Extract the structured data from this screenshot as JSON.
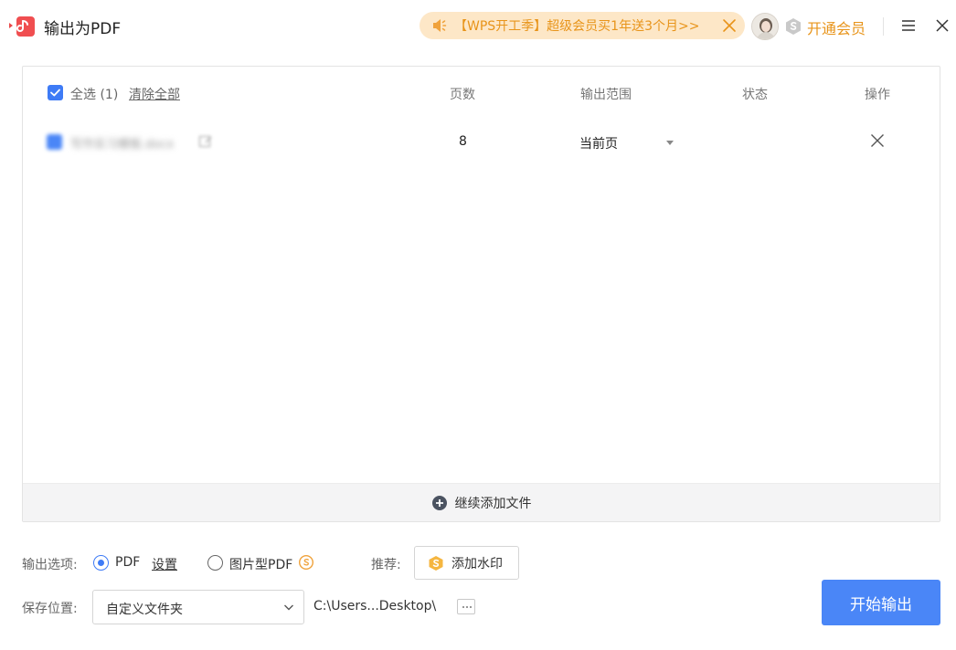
{
  "window": {
    "title": "输出为PDF",
    "promo_text": "【WPS开工季】超级会员买1年送3个月>>",
    "vip_label": "开通会员"
  },
  "list": {
    "select_all_label": "全选",
    "select_all_count": "(1)",
    "clear_all_label": "清除全部",
    "columns": {
      "pages": "页数",
      "range": "输出范围",
      "status": "状态",
      "action": "操作"
    },
    "rows": [
      {
        "file_name": "写作实习模板.docx",
        "pages": "8",
        "range": "当前页",
        "status": ""
      }
    ],
    "add_more_label": "继续添加文件"
  },
  "options": {
    "label": "输出选项:",
    "pdf_label": "PDF",
    "settings_label": "设置",
    "image_pdf_label": "图片型PDF",
    "selected": "PDF"
  },
  "recommend": {
    "label": "推荐:",
    "watermark_label": "添加水印"
  },
  "save": {
    "label": "保存位置:",
    "folder": "自定义文件夹",
    "path": "C:\\Users...Desktop\\"
  },
  "start_label": "开始输出",
  "colors": {
    "accent": "#4a86f7",
    "promo_text": "#e8941a",
    "promo_bg": "#fde7c7"
  }
}
